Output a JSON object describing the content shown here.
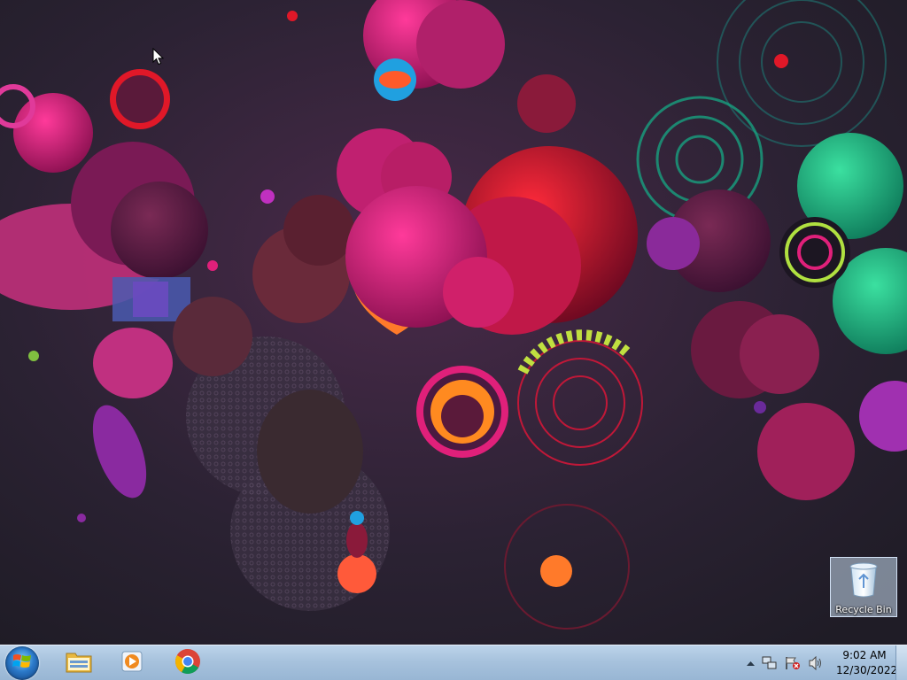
{
  "desktop": {
    "icons": [
      {
        "label": "Recycle Bin",
        "icon": "recycle-bin-icon"
      }
    ]
  },
  "taskbar": {
    "start_icon": "windows-logo-icon",
    "pinned": [
      {
        "name": "File Explorer",
        "icon": "folder-icon"
      },
      {
        "name": "Windows Media Player",
        "icon": "media-player-icon"
      },
      {
        "name": "Google Chrome",
        "icon": "chrome-icon"
      }
    ],
    "tray": {
      "icons": [
        "show-hidden-icons-arrow",
        "network-icon",
        "action-center-flag-icon",
        "volume-icon"
      ],
      "time": "9:02 AM",
      "date": "12/30/2022"
    }
  },
  "colors": {
    "taskbar_top": "#bcd3ea",
    "taskbar_bottom": "#98b6d4",
    "wallpaper_base": "#241c2c",
    "accent_magenta": "#e0207a",
    "accent_green": "#20b080"
  }
}
